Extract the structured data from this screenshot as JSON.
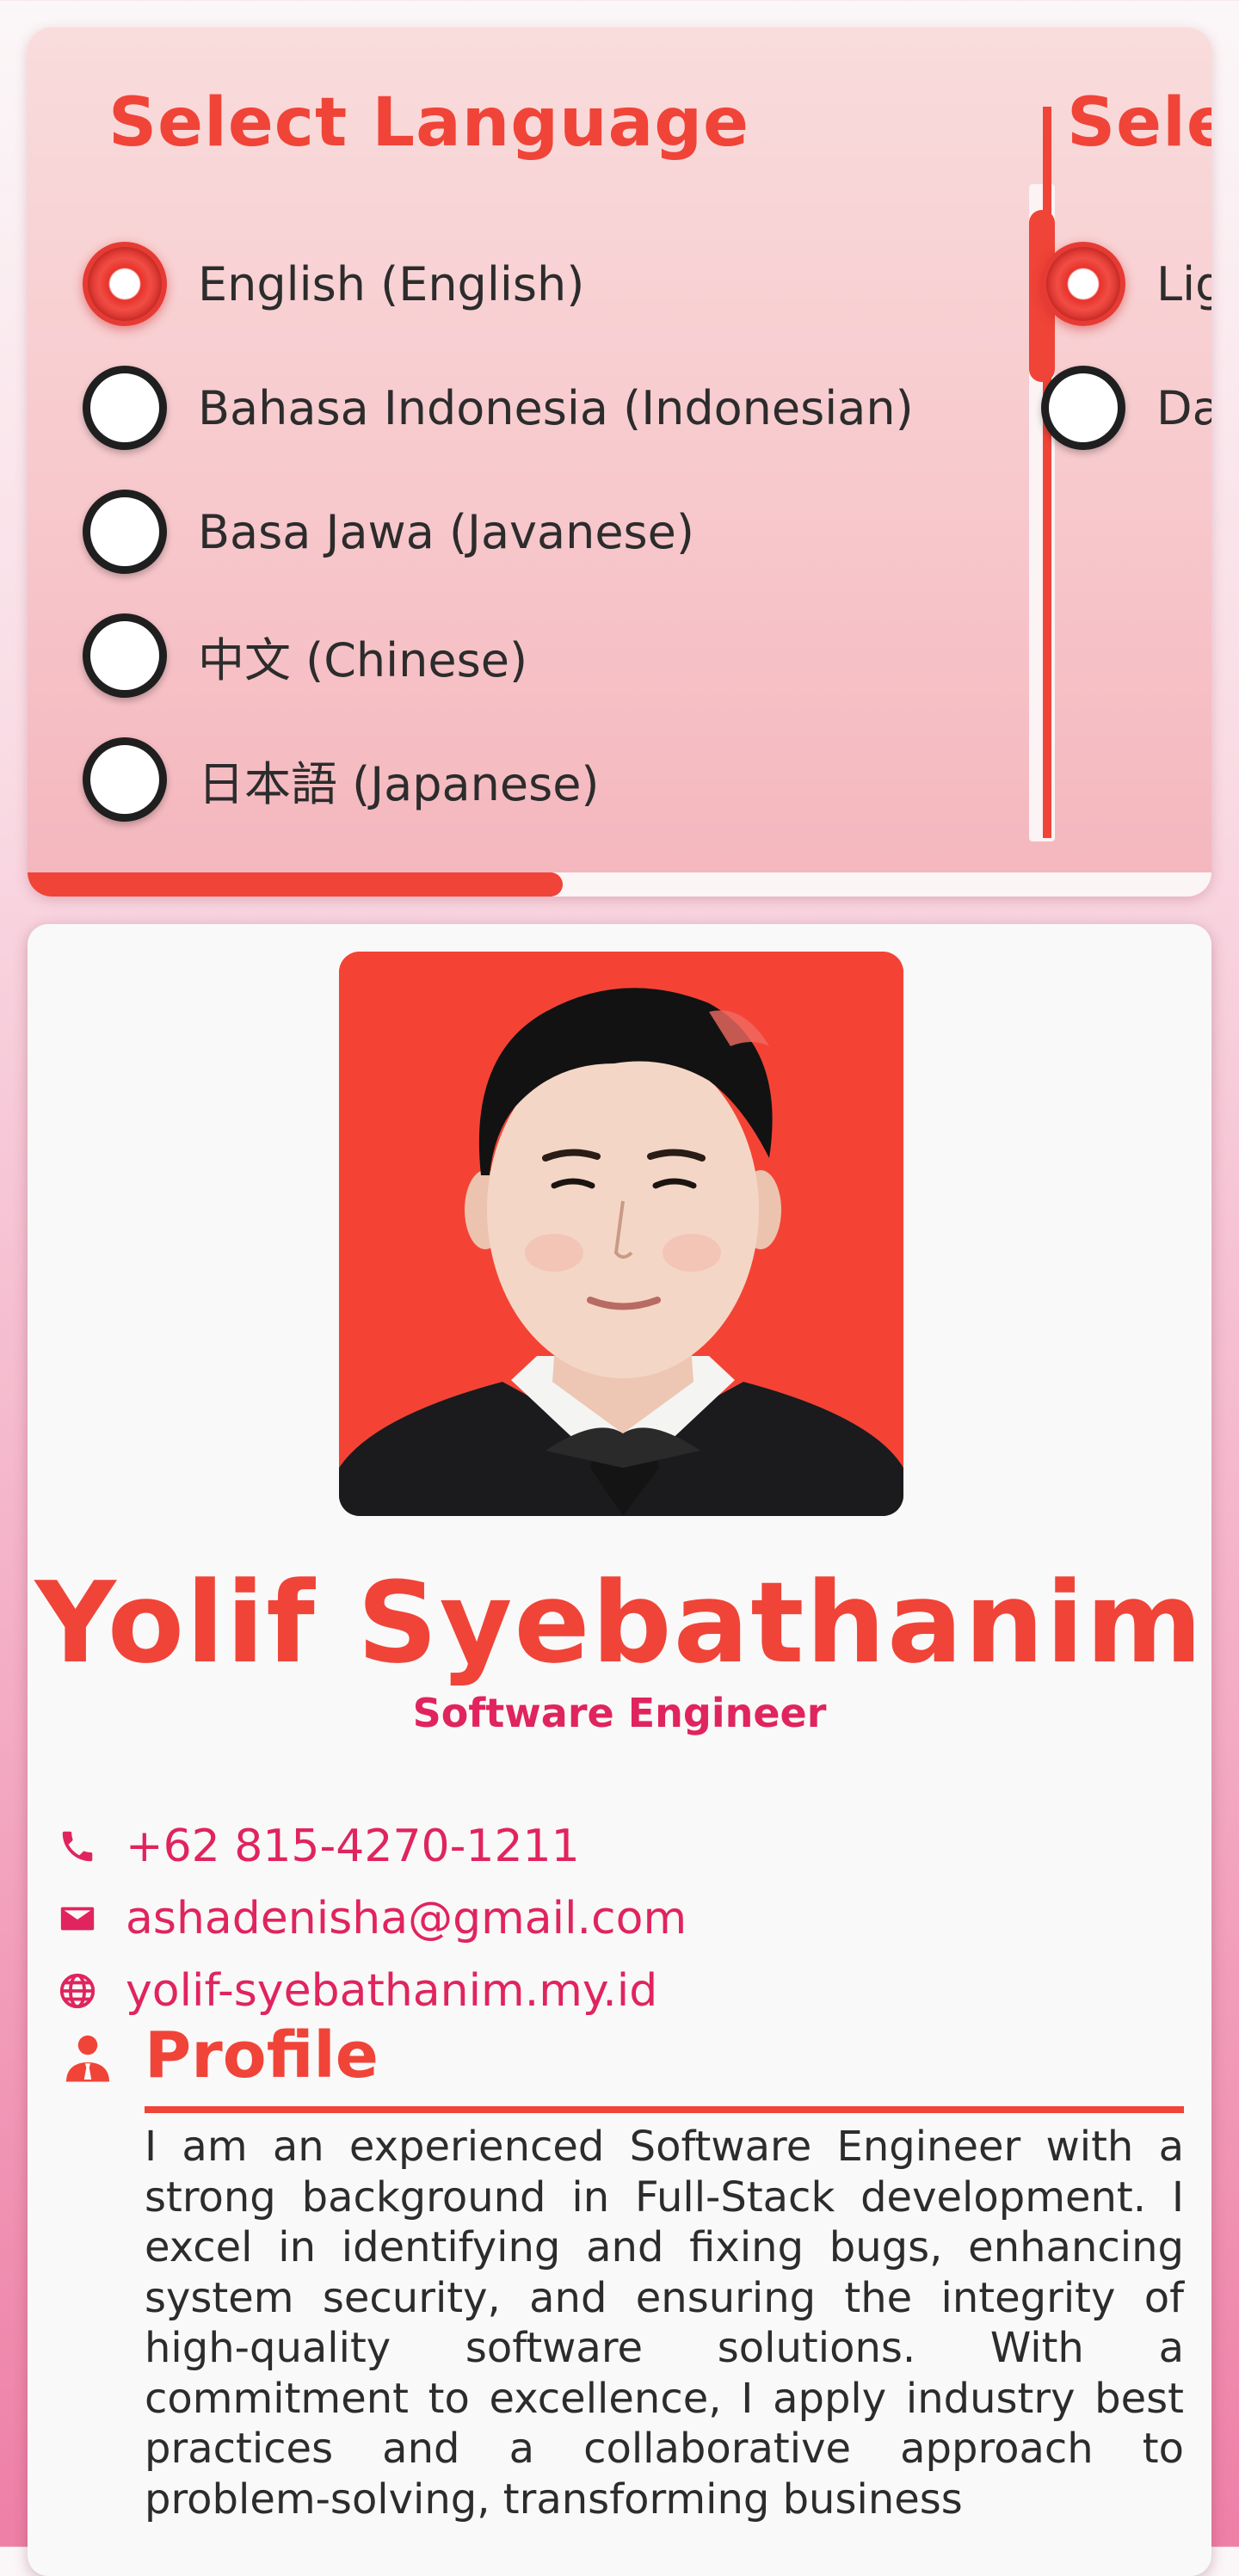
{
  "language_selector": {
    "title": "Select Language",
    "options": [
      {
        "label": "English (English)",
        "selected": true
      },
      {
        "label": "Bahasa Indonesia (Indonesian)",
        "selected": false
      },
      {
        "label": "Basa Jawa (Javanese)",
        "selected": false
      },
      {
        "label": "中文 (Chinese)",
        "selected": false
      },
      {
        "label": "日本語 (Japanese)",
        "selected": false
      }
    ],
    "list_scroll_fraction": 0.0,
    "carousel_scroll_fraction": 0.45
  },
  "theme_selector": {
    "title": "Selec",
    "options": [
      {
        "label": "Lig",
        "selected": true
      },
      {
        "label": "Da",
        "selected": false
      }
    ]
  },
  "profile": {
    "name": "Yolif Syebathanim",
    "role": "Software Engineer",
    "contacts": [
      {
        "icon": "phone-icon",
        "text": "+62 815-4270-1211"
      },
      {
        "icon": "mail-icon",
        "text": "ashadenisha@gmail.com"
      },
      {
        "icon": "globe-icon",
        "text": "yolif-syebathanim.my.id"
      }
    ],
    "section": {
      "icon": "user-tie-icon",
      "title": "Profile",
      "body": "I am an experienced Software Engineer with a strong background in Full-Stack development. I excel in identifying and fixing bugs, enhancing system security, and ensuring the integrity of high-quality software solutions. With a commitment to excellence, I apply industry best practices and a collaborative approach to problem-solving, transforming business"
    }
  },
  "colors": {
    "accent": "#f04438",
    "link": "#e0245e",
    "photo_background": "#f44335"
  }
}
